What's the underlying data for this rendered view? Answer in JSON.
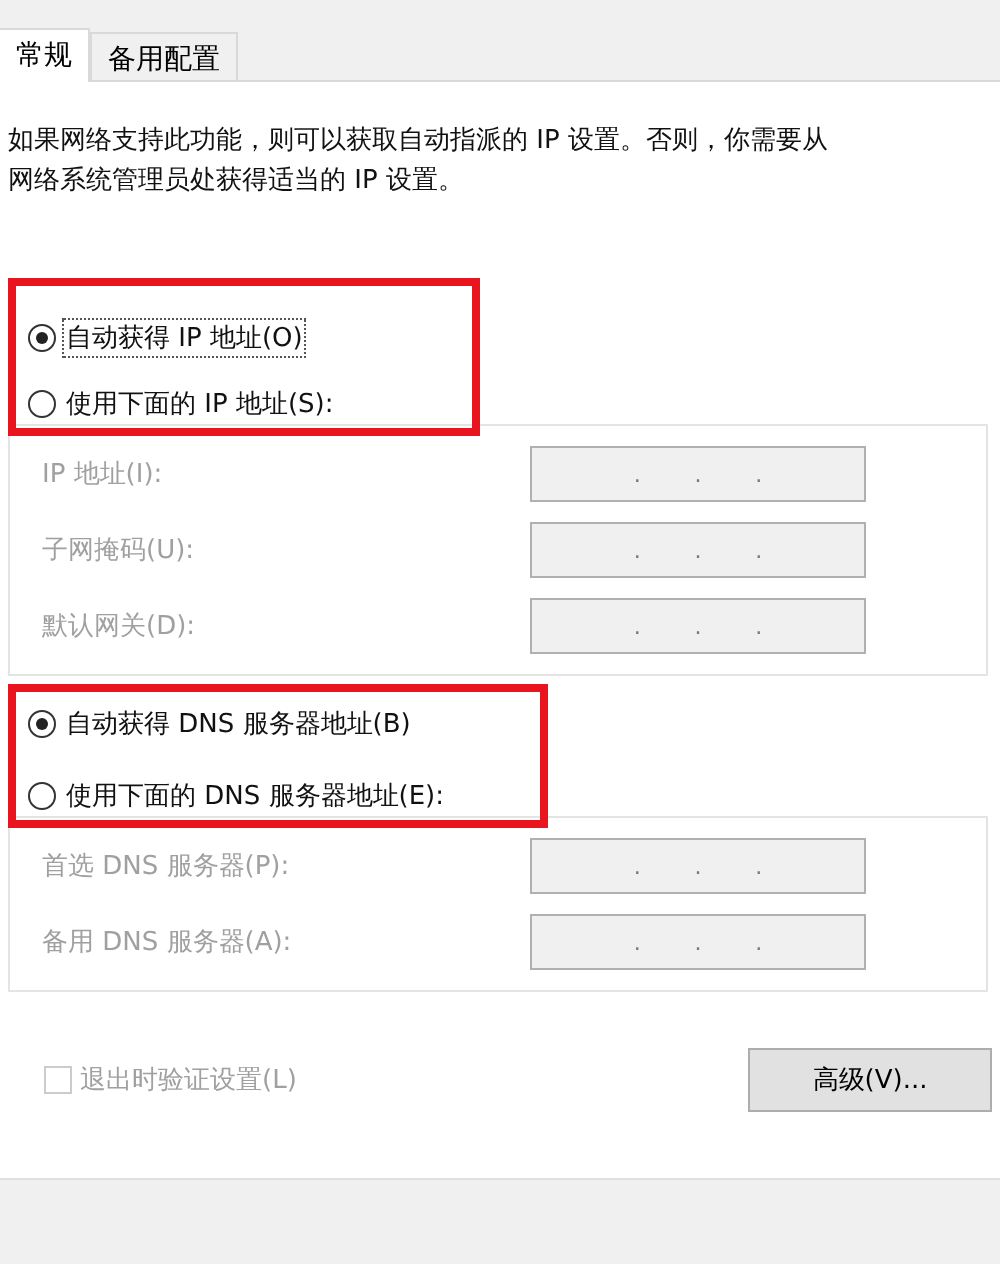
{
  "tabs": [
    {
      "label": "常规",
      "selected": true
    },
    {
      "label": "备用配置",
      "selected": false
    }
  ],
  "description": "如果网络支持此功能，则可以获取自动指派的 IP 设置。否则，你需要从网络系统管理员处获得适当的 IP 设置。",
  "sections": [
    {
      "highlighted": true,
      "options": [
        {
          "label": "自动获得 IP 地址(O)",
          "selected": true,
          "focused": true
        },
        {
          "label": "使用下面的 IP 地址(S):",
          "selected": false,
          "focused": false
        }
      ],
      "fields": [
        {
          "label": "IP 地址(I):",
          "disabled": true,
          "separators": [
            ".",
            ".",
            "."
          ]
        },
        {
          "label": "子网掩码(U):",
          "disabled": true,
          "separators": [
            ".",
            ".",
            "."
          ]
        },
        {
          "label": "默认网关(D):",
          "disabled": true,
          "separators": [
            ".",
            ".",
            "."
          ]
        }
      ]
    },
    {
      "highlighted": true,
      "options": [
        {
          "label": "自动获得 DNS 服务器地址(B)",
          "selected": true,
          "focused": false
        },
        {
          "label": "使用下面的 DNS 服务器地址(E):",
          "selected": false,
          "focused": false
        }
      ],
      "fields": [
        {
          "label": "首选 DNS 服务器(P):",
          "disabled": true,
          "separators": [
            ".",
            ".",
            "."
          ]
        },
        {
          "label": "备用 DNS 服务器(A):",
          "disabled": true,
          "separators": [
            ".",
            ".",
            "."
          ]
        }
      ]
    }
  ],
  "validate_checkbox": {
    "label": "退出时验证设置(L)",
    "checked": false,
    "disabled": true
  },
  "advanced_button": "高级(V)..."
}
